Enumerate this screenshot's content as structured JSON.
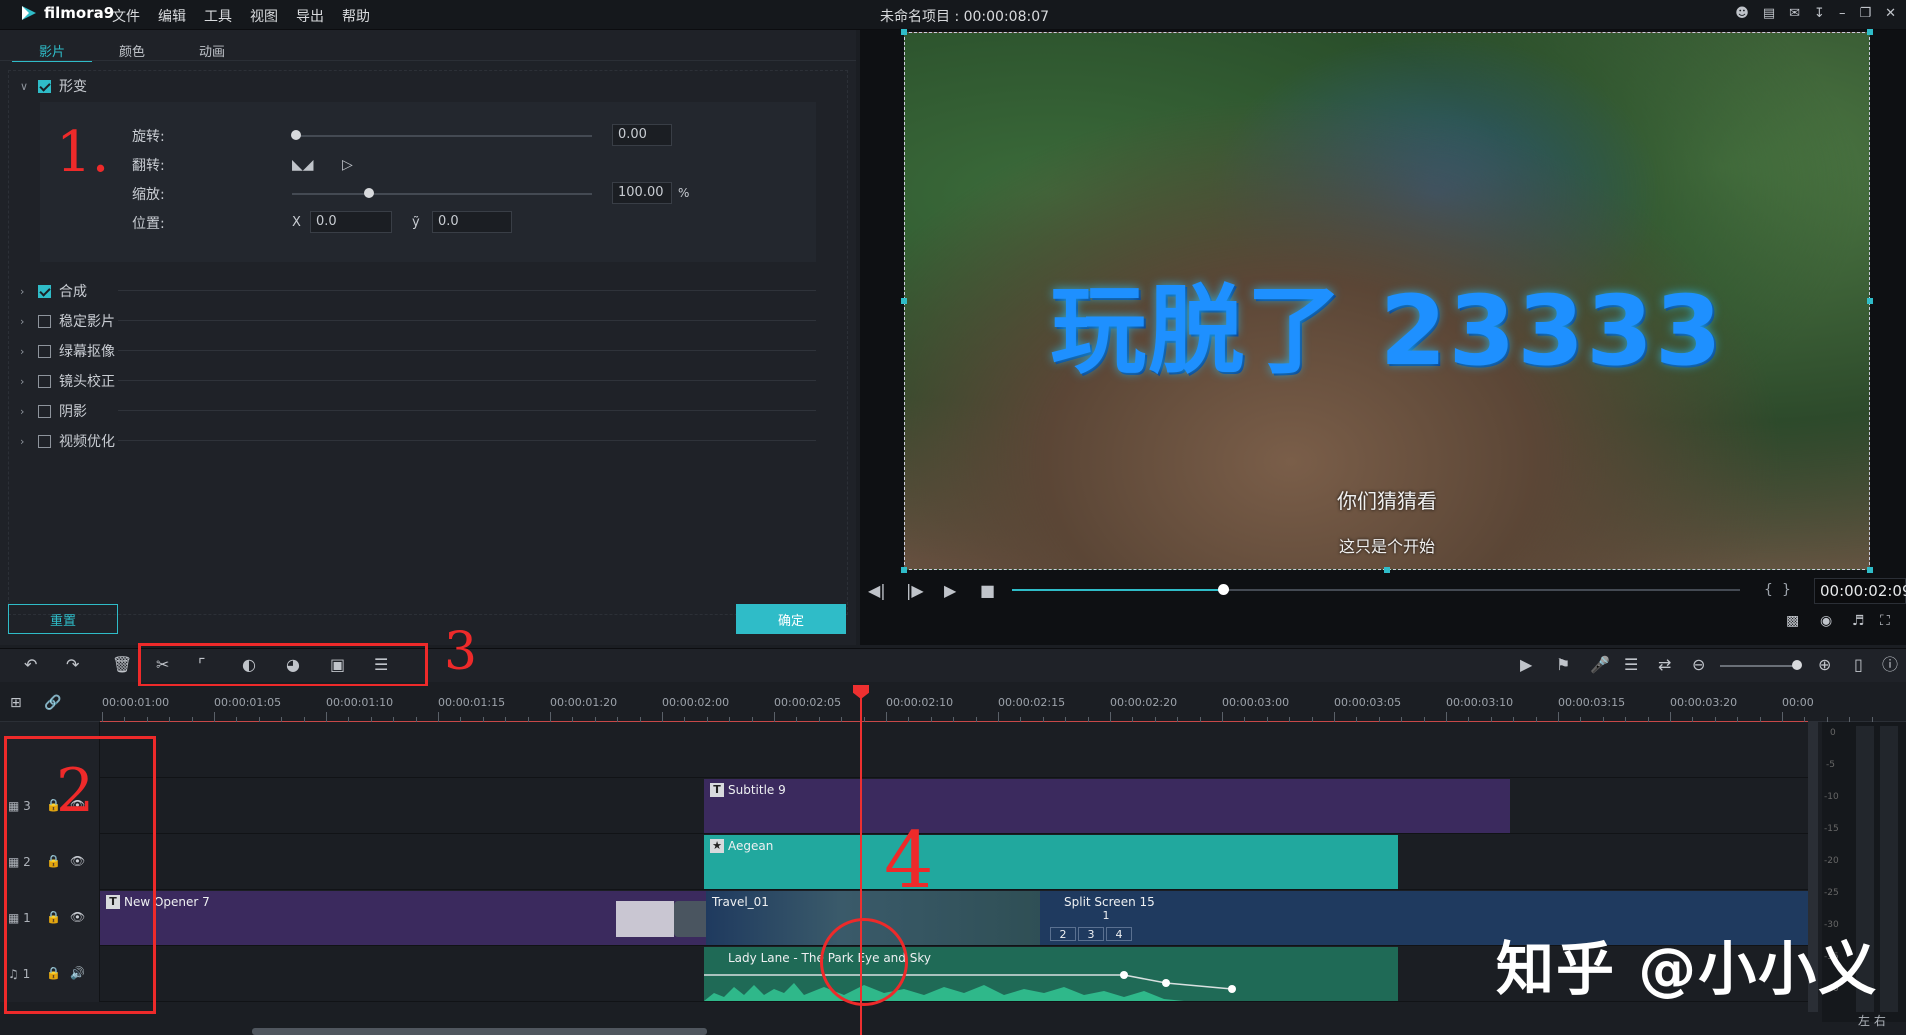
{
  "app": {
    "name": "filmora9",
    "menu": [
      "文件",
      "编辑",
      "工具",
      "视图",
      "导出",
      "帮助"
    ],
    "project_title": "未命名项目 : 00:00:08:07"
  },
  "panel": {
    "tabs": [
      "影片",
      "颜色",
      "动画"
    ],
    "transform": {
      "label": "形变",
      "rotate_label": "旋转:",
      "rotate_value": "0.00",
      "flip_label": "翻转:",
      "scale_label": "缩放:",
      "scale_value": "100.00",
      "scale_unit": "%",
      "position_label": "位置:",
      "x_label": "X",
      "x_value": "0.0",
      "y_label": "ỹ",
      "y_value": "0.0"
    },
    "sections": [
      {
        "label": "合成",
        "checked": true
      },
      {
        "label": "稳定影片",
        "checked": false
      },
      {
        "label": "绿幕抠像",
        "checked": false
      },
      {
        "label": "镜头校正",
        "checked": false
      },
      {
        "label": "阴影",
        "checked": false
      },
      {
        "label": "视频优化",
        "checked": false
      }
    ],
    "reset_label": "重置",
    "ok_label": "确定"
  },
  "preview": {
    "title_text": "玩脱了 23333",
    "subtitle1": "你们猜猜看",
    "subtitle2": "这只是个开始",
    "timecode": "00:00:02:09",
    "progress": 0.29,
    "bracket_open": "{",
    "bracket_close": "}"
  },
  "annotations": {
    "a1": "1.",
    "a2": "2",
    "a3": "3",
    "a4": "4"
  },
  "ruler": {
    "labels": [
      "00:00:01:00",
      "00:00:01:05",
      "00:00:01:10",
      "00:00:01:15",
      "00:00:01:20",
      "00:00:02:00",
      "00:00:02:05",
      "00:00:02:10",
      "00:00:02:15",
      "00:00:02:20",
      "00:00:03:00",
      "00:00:03:05",
      "00:00:03:10",
      "00:00:03:15",
      "00:00:03:20",
      "00:00"
    ]
  },
  "tracks": {
    "t3": "3",
    "t2": "2",
    "t1": "1",
    "audio": "1",
    "clips": {
      "subtitle": "Subtitle 9",
      "aegean": "Aegean",
      "opener": "New Opener 7",
      "travel": "Travel_01",
      "split": "Split Screen 15",
      "split_cells": [
        "1",
        "2",
        "3",
        "4"
      ],
      "audio": "Lady Lane - The Park Eye and Sky"
    }
  },
  "vu_labels": [
    "0",
    "-5",
    "-10",
    "-15",
    "-20",
    "-25",
    "-30",
    "-35",
    "-40"
  ],
  "vu_lr": "左 右",
  "watermark": "知乎 @小小义",
  "colors": {
    "accent": "#2fbcc8",
    "annotation": "#ee2a2a",
    "subtitle_clip": "#3b2a5e",
    "aegean_clip": "#21a89e",
    "video_clip": "#1f3a5f",
    "audio_clip": "#1f6a56"
  }
}
